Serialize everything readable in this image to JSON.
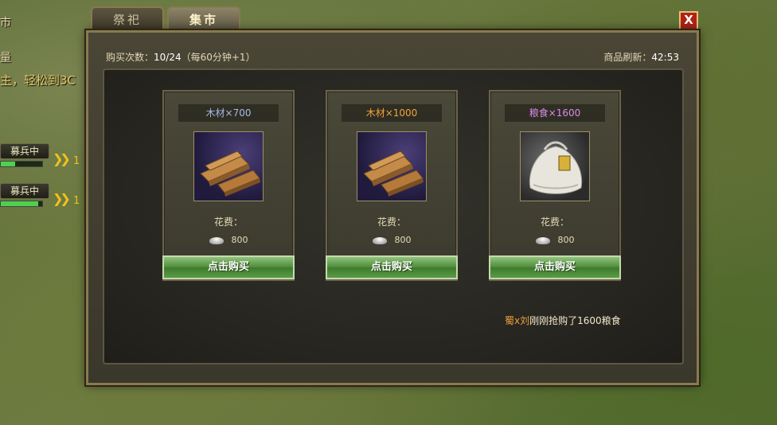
{
  "background": {
    "left_text_1": "市",
    "left_text_2": "量",
    "left_text_3": "主，轻松到3C",
    "recruit_1": "募兵中",
    "recruit_2": "募兵中",
    "recruit_count_1": "1",
    "recruit_count_2": "1",
    "recruit_progress_1": 0.35,
    "recruit_progress_2": 0.9
  },
  "tabs": [
    {
      "label": "祭祀",
      "active": false
    },
    {
      "label": "集市",
      "active": true
    }
  ],
  "close_label": "X",
  "header": {
    "purchases_label": "购买次数：",
    "purchases_value": "10/24",
    "purchases_note": "（每60分钟+1）",
    "refresh_label": "商品刷新：",
    "refresh_value": "42:53"
  },
  "items": [
    {
      "name": "木材×700",
      "name_color": "#a6b9e8",
      "icon": "wood-planks-icon",
      "cost_label": "花费：",
      "cost": "800",
      "button": "点击购买"
    },
    {
      "name": "木材×1000",
      "name_color": "#f3a23a",
      "icon": "wood-planks-icon",
      "cost_label": "花费：",
      "cost": "800",
      "button": "点击购买"
    },
    {
      "name": "粮食×1600",
      "name_color": "#d98ae8",
      "icon": "grain-sack-icon",
      "cost_label": "花费：",
      "cost": "800",
      "button": "点击购买"
    }
  ],
  "notice": {
    "who": "蜀x刘",
    "text": "刚刚抢购了1600粮食"
  }
}
